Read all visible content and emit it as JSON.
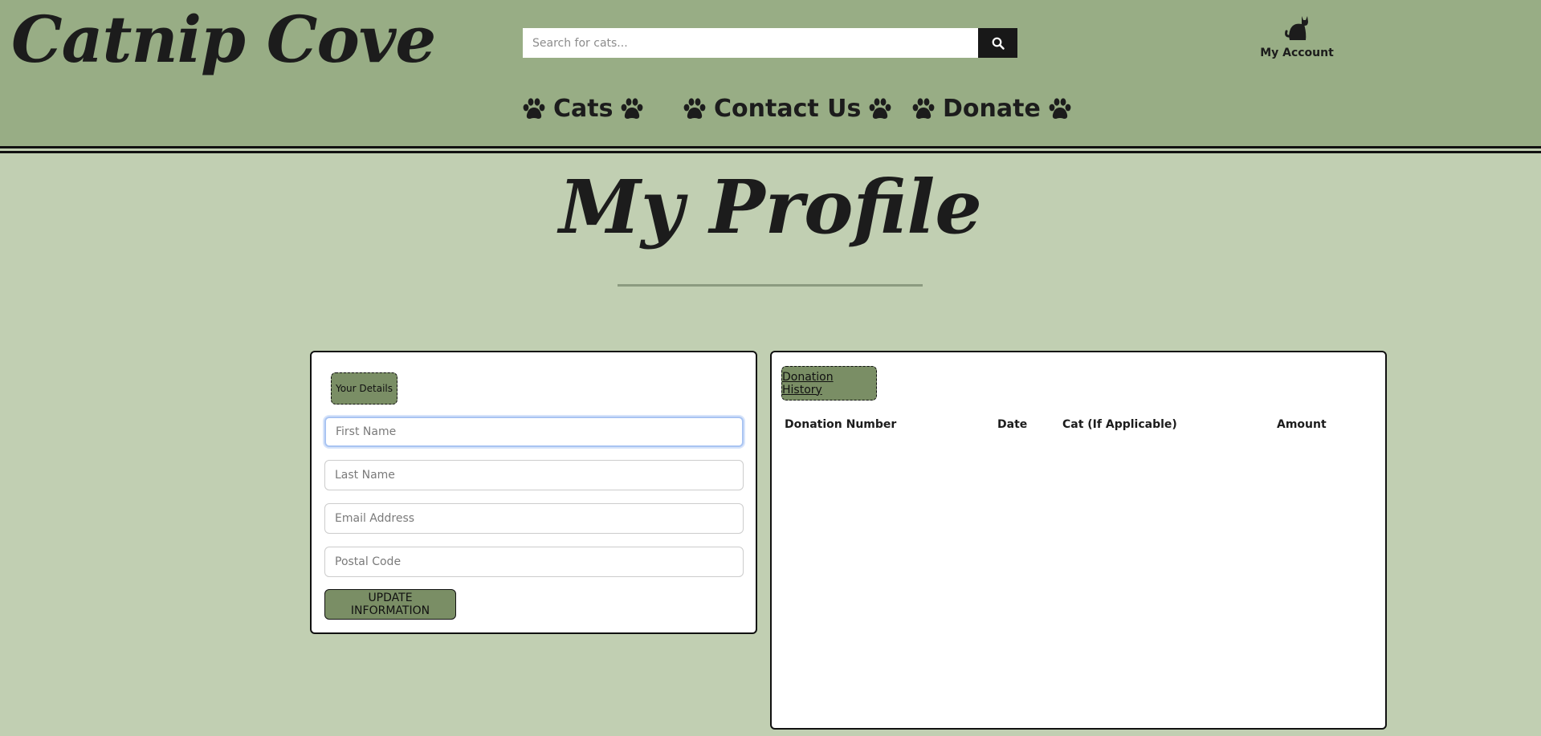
{
  "header": {
    "logo": "Catnip Cove",
    "search": {
      "placeholder": "Search for cats...",
      "icon": "search-icon"
    },
    "account": {
      "label": "My Account",
      "icon": "cat-icon"
    },
    "nav": [
      {
        "label": "Cats",
        "icon": "paw-icon"
      },
      {
        "label": "Contact Us",
        "icon": "paw-icon"
      },
      {
        "label": "Donate",
        "icon": "paw-icon"
      }
    ]
  },
  "page": {
    "title": "My Profile"
  },
  "details": {
    "tag": "Your Details",
    "fields": [
      {
        "placeholder": "First Name",
        "value": ""
      },
      {
        "placeholder": "Last Name",
        "value": ""
      },
      {
        "placeholder": "Email Address",
        "value": ""
      },
      {
        "placeholder": "Postal Code",
        "value": ""
      }
    ],
    "button": "UPDATE INFORMATION"
  },
  "history": {
    "tag": "Donation History",
    "columns": [
      "Donation Number",
      "Date",
      "Cat (If Applicable)",
      "Amount"
    ],
    "rows": []
  },
  "colors": {
    "header_bg": "#98ad85",
    "page_bg": "#c1cfb2",
    "accent": "#7a8e65",
    "text": "#1c1c1c"
  }
}
